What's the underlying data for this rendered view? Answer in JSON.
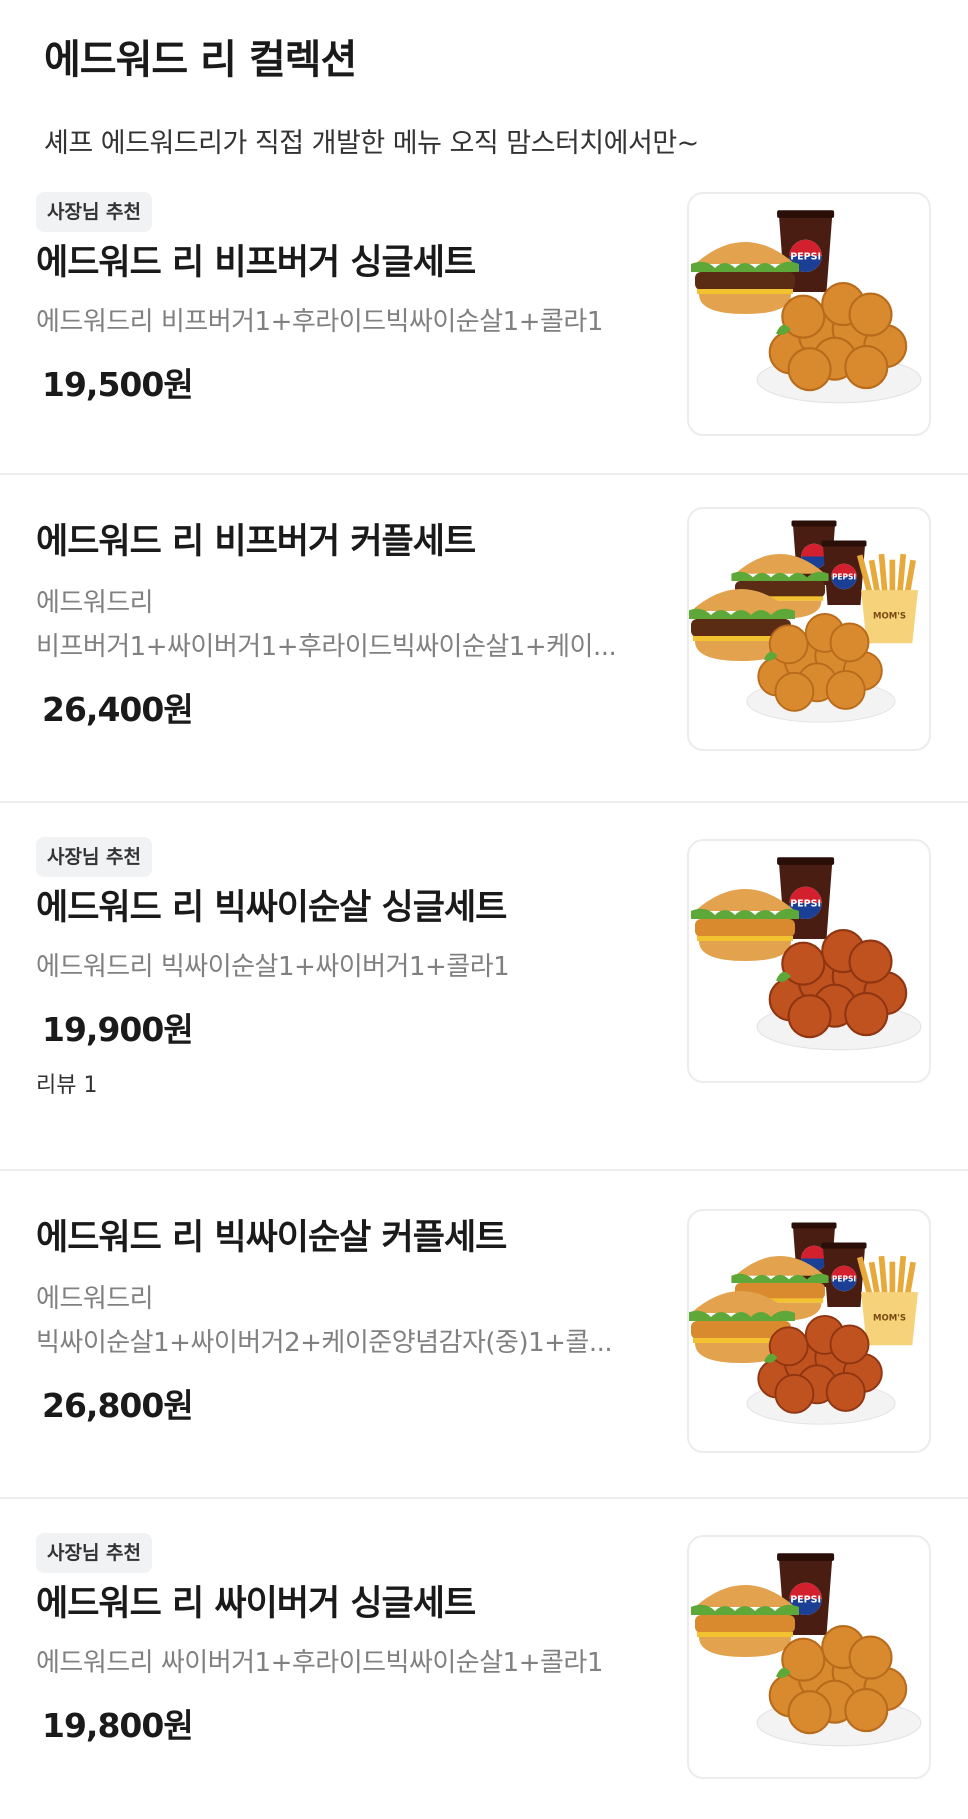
{
  "header": {
    "title": "에드워드 리 컬렉션",
    "subtitle": "셰프 에드워드리가 직접 개발한 메뉴 오직 맘스터치에서만~"
  },
  "menu_items": [
    {
      "badge": "사장님 추천",
      "name": "에드워드 리 비프버거 싱글세트",
      "desc_line1": "에드워드리 비프버거1+후라이드빅싸이순살1+콜라1",
      "desc_line2": "",
      "price": "19,500원",
      "review": "",
      "image_icon": "burger-chicken-cola-set-image"
    },
    {
      "badge": "",
      "name": "에드워드 리 비프버거 커플세트",
      "desc_line1": "에드워드리",
      "desc_line2": "비프버거1+싸이버거1+후라이드빅싸이순살1+케이...",
      "price": "26,400원",
      "review": "",
      "image_icon": "couple-set-image"
    },
    {
      "badge": "사장님 추천",
      "name": "에드워드 리 빅싸이순살 싱글세트",
      "desc_line1": "에드워드리 빅싸이순살1+싸이버거1+콜라1",
      "desc_line2": "",
      "price": "19,900원",
      "review": "리뷰 1",
      "image_icon": "sauced-chicken-set-image"
    },
    {
      "badge": "",
      "name": "에드워드 리 빅싸이순살 커플세트",
      "desc_line1": "에드워드리",
      "desc_line2": "빅싸이순살1+싸이버거2+케이준양념감자(중)1+콜...",
      "price": "26,800원",
      "review": "",
      "image_icon": "sauced-couple-set-image"
    },
    {
      "badge": "사장님 추천",
      "name": "에드워드 리 싸이버거 싱글세트",
      "desc_line1": "에드워드리 싸이버거1+후라이드빅싸이순살1+콜라1",
      "desc_line2": "",
      "price": "19,800원",
      "review": "",
      "image_icon": "thigh-burger-set-image"
    }
  ],
  "image_text": {
    "cola_brand": "PEPSI",
    "fries_brand": "MOM'S"
  },
  "colors": {
    "chicken": "#d9892e",
    "chicken_sauced": "#c0521f",
    "bun": "#e2a24e",
    "lettuce": "#5ea83a",
    "cola": "#4a1d12",
    "pepsi_blue": "#1a3f95",
    "pepsi_red": "#d3202f"
  }
}
